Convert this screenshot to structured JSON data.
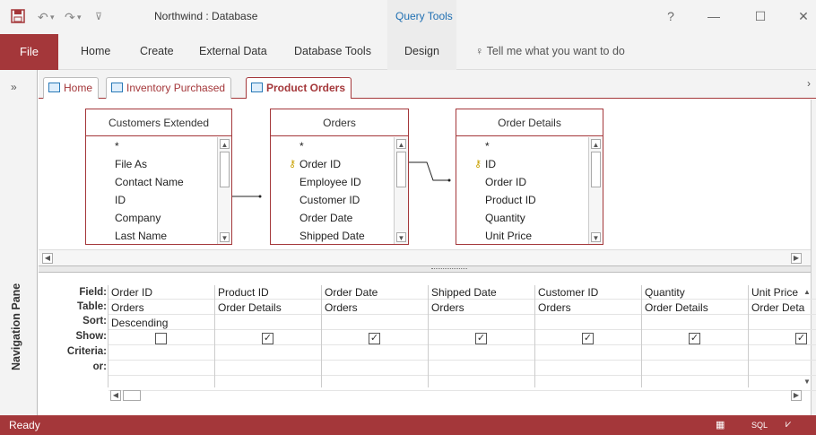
{
  "app": {
    "title": "Northwind : Database",
    "context_tab": "Query Tools"
  },
  "qat": {
    "save_icon": "save-icon",
    "undo_icon": "undo-icon",
    "redo_icon": "redo-icon",
    "customize_icon": "customize-qat-icon"
  },
  "window_controls": {
    "help": "?",
    "minimize": "—",
    "maximize": "☐",
    "close": "✕"
  },
  "ribbon": {
    "tabs": [
      "File",
      "Home",
      "Create",
      "External Data",
      "Database Tools",
      "Design"
    ],
    "tell_me": "Tell me what you want to do"
  },
  "nav_pane": {
    "label": "Navigation Pane",
    "collapse": "»"
  },
  "doc_tabs": [
    {
      "label": "Home"
    },
    {
      "label": "Inventory Purchased"
    },
    {
      "label": "Product Orders"
    }
  ],
  "tables": [
    {
      "name": "Customers Extended",
      "fields": [
        "*",
        "File As",
        "Contact Name",
        "ID",
        "Company",
        "Last Name"
      ]
    },
    {
      "name": "Orders",
      "fields": [
        "*",
        "Order ID",
        "Employee ID",
        "Customer ID",
        "Order Date",
        "Shipped Date"
      ]
    },
    {
      "name": "Order Details",
      "fields": [
        "*",
        "ID",
        "Order ID",
        "Product ID",
        "Quantity",
        "Unit Price"
      ]
    }
  ],
  "grid": {
    "row_labels": [
      "Field:",
      "Table:",
      "Sort:",
      "Show:",
      "Criteria:",
      "or:"
    ],
    "columns": [
      {
        "field": "Order ID",
        "table": "Orders",
        "sort": "Descending",
        "show": false
      },
      {
        "field": "Product ID",
        "table": "Order Details",
        "sort": "",
        "show": true
      },
      {
        "field": "Order Date",
        "table": "Orders",
        "sort": "",
        "show": true
      },
      {
        "field": "Shipped Date",
        "table": "Orders",
        "sort": "",
        "show": true
      },
      {
        "field": "Customer ID",
        "table": "Orders",
        "sort": "",
        "show": true
      },
      {
        "field": "Quantity",
        "table": "Order Details",
        "sort": "",
        "show": true
      },
      {
        "field": "Unit Price",
        "table": "Order Deta",
        "sort": "",
        "show": true
      }
    ]
  },
  "status": {
    "text": "Ready",
    "sql_label": "SQL"
  },
  "colors": {
    "accent": "#a4373a",
    "context_tab": "#1f6fb2"
  }
}
